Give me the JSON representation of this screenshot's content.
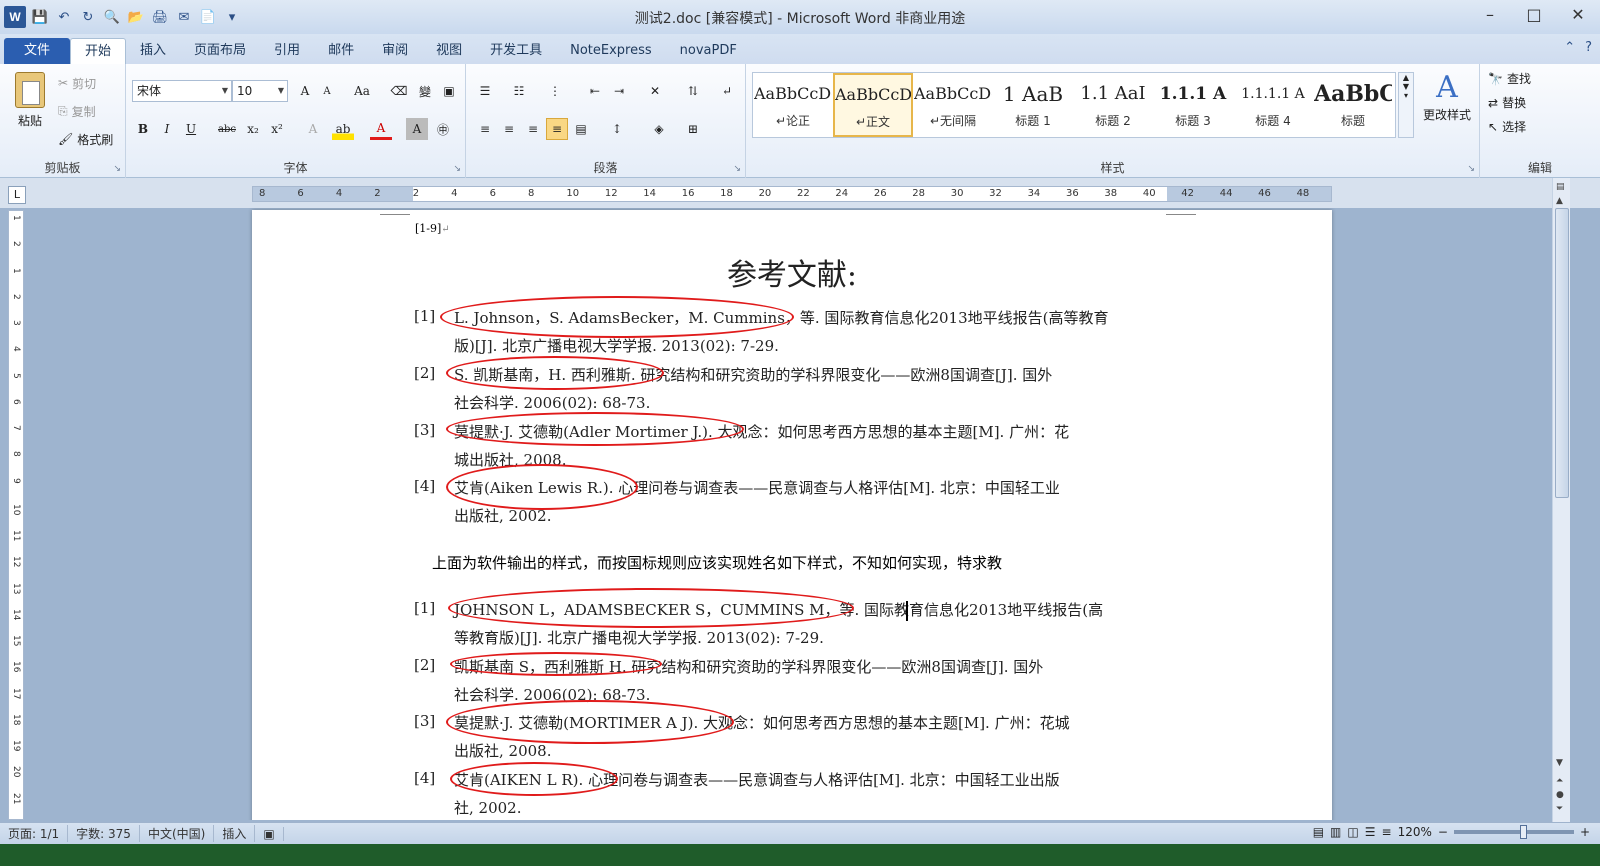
{
  "window": {
    "title": "测试2.doc [兼容模式] - Microsoft Word 非商业用途",
    "app_logo": "W",
    "controls": {
      "minimize": "–",
      "maximize": "□",
      "close": "✕"
    }
  },
  "qat": {
    "icons": [
      "save-icon",
      "undo-icon",
      "redo-icon",
      "print-preview-icon",
      "open-icon",
      "print-icon",
      "email-icon",
      "new-icon",
      "customize-icon"
    ]
  },
  "tabs": [
    {
      "label": "文件"
    },
    {
      "label": "开始"
    },
    {
      "label": "插入"
    },
    {
      "label": "页面布局"
    },
    {
      "label": "引用"
    },
    {
      "label": "邮件"
    },
    {
      "label": "审阅"
    },
    {
      "label": "视图"
    },
    {
      "label": "开发工具"
    },
    {
      "label": "NoteExpress"
    },
    {
      "label": "novaPDF"
    }
  ],
  "ribbon": {
    "clipboard": {
      "group_label": "剪贴板",
      "paste": "粘贴",
      "cut": "剪切",
      "copy": "复制",
      "format_painter": "格式刷"
    },
    "font": {
      "group_label": "字体",
      "font_name": "宋体",
      "font_size": "10",
      "bold": "B",
      "italic": "I",
      "underline": "U",
      "strike": "abc",
      "subscript": "x₂",
      "superscript": "x²",
      "grow": "A",
      "shrink": "A",
      "change_case": "Aa"
    },
    "paragraph": {
      "group_label": "段落"
    },
    "styles": {
      "group_label": "样式",
      "cards": [
        {
          "sample": "AaBbCcDc",
          "name": "↵论正"
        },
        {
          "sample": "AaBbCcDc",
          "name": "↵正文"
        },
        {
          "sample": "AaBbCcDc",
          "name": "↵无间隔"
        },
        {
          "sample": "1 AaB",
          "name": "标题 1"
        },
        {
          "sample": "1.1 AaI",
          "name": "标题 2"
        },
        {
          "sample": "1.1.1 A",
          "name": "标题 3"
        },
        {
          "sample": "1.1.1.1 A",
          "name": "标题 4"
        },
        {
          "sample": "AaBbC",
          "name": "标题"
        }
      ],
      "selected_index": 1,
      "change_styles": "更改样式"
    },
    "editing": {
      "group_label": "编辑",
      "find": "查找",
      "replace": "替换",
      "select": "选择"
    }
  },
  "ruler": {
    "labels": [
      "8",
      "6",
      "4",
      "2",
      "2",
      "4",
      "6",
      "8",
      "10",
      "12",
      "14",
      "16",
      "18",
      "20",
      "22",
      "24",
      "26",
      "28",
      "30",
      "32",
      "34",
      "36",
      "38",
      "40",
      "42",
      "44",
      "46",
      "48"
    ],
    "vlabels": [
      "1",
      "2",
      "1",
      "2",
      "3",
      "4",
      "5",
      "6",
      "7",
      "8",
      "9",
      "10",
      "11",
      "12",
      "13",
      "14",
      "15",
      "16",
      "17",
      "18",
      "19",
      "20",
      "21"
    ]
  },
  "document": {
    "top_ref": "[1-9]",
    "title": "参考文献:",
    "refs_a": [
      {
        "num": "[1]",
        "line1": "L. Johnson，S. AdamsBecker，M. Cummins，等. 国际教育信息化2013地平线报告(高等教育",
        "line2": "版)[J]. 北京广播电视大学学报. 2013(02): 7-29."
      },
      {
        "num": "[2]",
        "line1": "S. 凯斯基南，H. 西利雅斯. 研究结构和研究资助的学科界限变化——欧洲8国调查[J]. 国外",
        "line2": "社会科学. 2006(02): 68-73."
      },
      {
        "num": "[3]",
        "line1": "莫提默·J. 艾德勒(Adler Mortimer J.). 大观念：如何思考西方思想的基本主题[M]. 广州：花",
        "line2": "城出版社, 2008."
      },
      {
        "num": "[4]",
        "line1": "艾肯(Aiken Lewis R.). 心理问卷与调查表——民意调查与人格评估[M]. 北京：中国轻工业",
        "line2": "出版社, 2002."
      }
    ],
    "middle_note": "上面为软件输出的样式，而按国标规则应该实现姓名如下样式，不知如何实现，特求教",
    "refs_b": [
      {
        "num": "[1]",
        "line1": "JOHNSON L，ADAMSBECKER S，CUMMINS M，等. 国际教育信息化2013地平线报告(高",
        "line2": "等教育版)[J]. 北京广播电视大学学报. 2013(02): 7-29."
      },
      {
        "num": "[2]",
        "line1": "凯斯基南 S，西利雅斯 H. 研究结构和研究资助的学科界限变化——欧洲8国调查[J]. 国外",
        "line2": "社会科学. 2006(02): 68-73."
      },
      {
        "num": "[3]",
        "line1": "莫提默·J. 艾德勒(MORTIMER A J). 大观念：如何思考西方思想的基本主题[M]. 广州：花城",
        "line2": "出版社, 2008."
      },
      {
        "num": "[4]",
        "line1": "艾肯(AIKEN L R). 心理问卷与调查表——民意调查与人格评估[M]. 北京：中国轻工业出版",
        "line2": "社, 2002."
      }
    ],
    "para_mark": "↵"
  },
  "statusbar": {
    "page": "页面: 1/1",
    "words": "字数: 375",
    "language": "中文(中国)",
    "insert_mode": "插入",
    "zoom": "120%",
    "zoom_out": "−",
    "zoom_in": "+"
  },
  "colors": {
    "ellipse": "#e01b1b",
    "file_tab": "#2b5eb0"
  }
}
